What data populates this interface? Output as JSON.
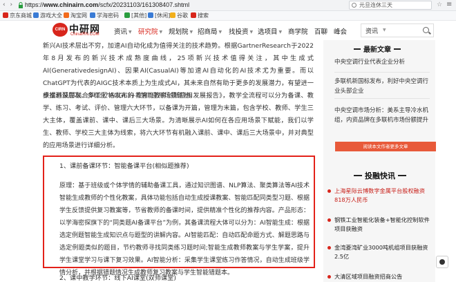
{
  "browser": {
    "url_prefix": "https://",
    "url_host": "www.chinairn.com",
    "url_path": "/scfx/20231103/161308407.shtml",
    "search_value": "元旦连休三天",
    "bookmarks": [
      "京东商城",
      "游戏大全",
      "淘宝网",
      "学海密码",
      "[其他]",
      "[休闲]",
      "谷歌",
      "搜索"
    ]
  },
  "site": {
    "logo_text": "中研网",
    "logo_en": "ChinaIRN.COM",
    "logo_badge": "CIRN",
    "nav": [
      "资讯",
      "研究院",
      "规划院",
      "招商局",
      "找投资",
      "选项目",
      "商学院",
      "百聊",
      "峰会"
    ],
    "search_type": "资讯"
  },
  "article": {
    "p1": "新兴AI技术层出不穷，加速AI自动化成为值得关注的技术趋势。根据GartnerResearch于2022年8月发布的新兴技术成熟度曲线，25项新兴技术值得关注，其中生成式AI(GenerativedesignAI)、因果AI(CasualAI)等加速AI自动化的AI技术尤为重要。而以ChatGPT为代表的AIGC技术本质上为生成式AI，其未来自然有助于更多的发展潜力，有望进一步推进深层次、多样化“AI(GC)+教育”应用场景落地。",
    "p2": "根据科技部联合华三贝格发布的《智能教育创新应用发展报告》，教学全流程可以分为备课、教学、练习、考试、评价、管理六大环节，以备课为开篇，管理为末篇，包含学校、教师、学生三大主体，覆盖课前、课中、课后三大场景。为清晰展示AI如何在各应用场景下赋能，我们以学生、教师、学校三大主体为线索，将六大环节有机融入课前、课中、课后三大场景中，并对典型的应用场景进行详细分析。",
    "section1_title": "1、课前备课环节：智能备课平台(相似题推荐)",
    "p3": "原理：基于班级或个体学情的辅助备课工具，通过知识图谱、NLP算法、聚类算法等AI技术智能生成教师的个性化教案，具体功能包括自动生成授课教案、智能匹配同类型习题、根据学生反馈提供复习教案等，节省教师的备课时间，提供精准个性化的推荐内容。产品形态：以学海密探旗下的“同类题AI备课平台”为例，其备课流程大体可以分为：AI智能生成：根据选定例题智能生成知识点与题型的讲解内容。AI智能匹配：自动匹配命题方式、解题思路与选定例题类似的题目，节约教师寻找同类练习题时间;智能生成教师教案与学生学案，提升学生课堂学习与课下复习效果。AI智能分析：采集学生课堂练习作答情况，自动生成班级学情分析，并根据错题情况生成教师复习教案与学生智能错题本。",
    "section2_title": "2、课中教学环节：线下AI课堂(双师课堂)"
  },
  "sidebar": {
    "latest_title": "最新文章",
    "latest_articles": [
      "中央空调行业代表企业分析",
      "多联机新国标发布，利好中央空调行业头部企业",
      "中央空调市场分析：美系主导冷水机组，内资品牌在多联机市场份额提升"
    ],
    "more_button": "阅读本文作者更多文章",
    "flash_title": "投融快讯",
    "flash_news": [
      {
        "text": "上海星际云博数字金属平台股权融资818万人民币",
        "time": "",
        "highlight": true
      },
      {
        "text": "钢铁工业智能化装备+智能化控制软件项目获融资",
        "time": "",
        "highlight": false
      },
      {
        "text": "金湾菱湾矿业3000吨机组项目获融资2.5亿",
        "time": "",
        "highlight": false
      },
      {
        "text": "大清区域项目融资招商公告",
        "time": "",
        "highlight": false
      }
    ]
  }
}
